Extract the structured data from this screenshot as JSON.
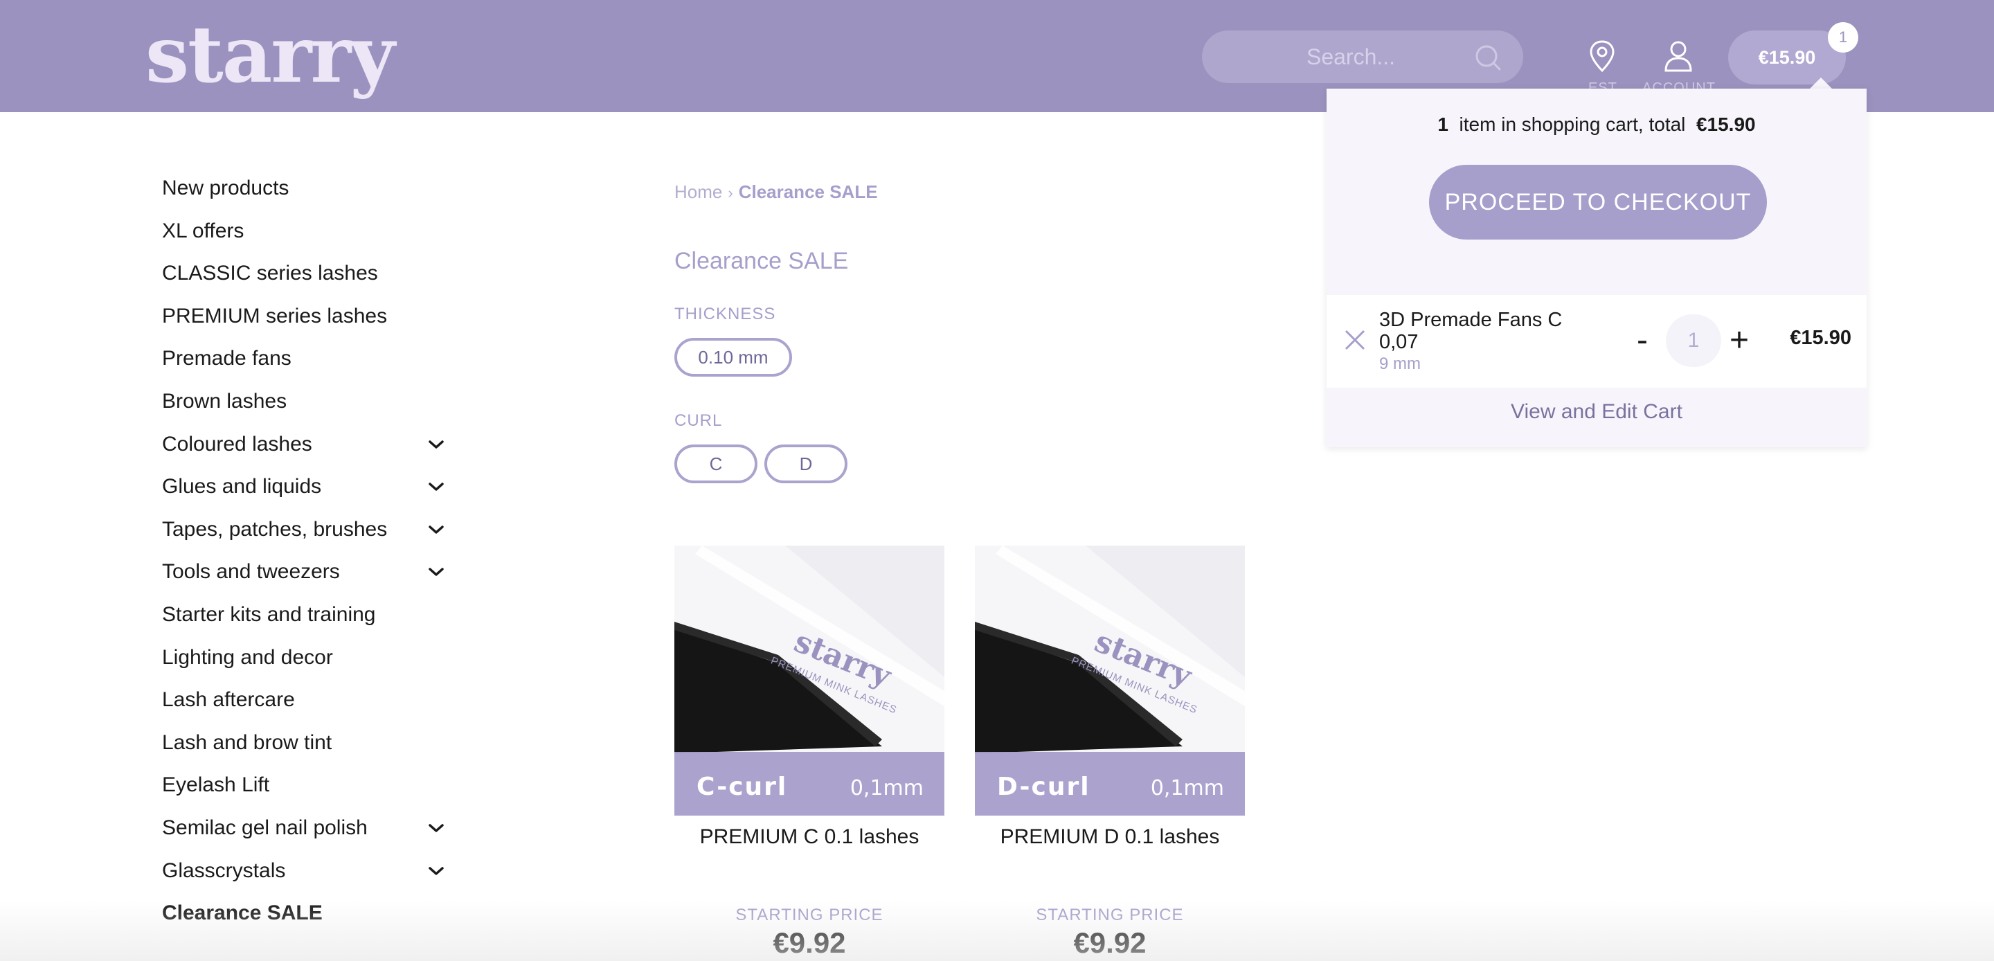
{
  "header": {
    "logo": "starry",
    "search_placeholder": "Search...",
    "est_label": "EST",
    "account_label": "ACCOUNT",
    "cart_total": "€15.90",
    "cart_count": "1"
  },
  "sidebar": {
    "items": [
      {
        "label": "New products",
        "expandable": false
      },
      {
        "label": "XL offers",
        "expandable": false
      },
      {
        "label": "CLASSIC series lashes",
        "expandable": false
      },
      {
        "label": "PREMIUM series lashes",
        "expandable": false
      },
      {
        "label": "Premade fans",
        "expandable": false
      },
      {
        "label": "Brown lashes",
        "expandable": false
      },
      {
        "label": "Coloured lashes",
        "expandable": true
      },
      {
        "label": "Glues and liquids",
        "expandable": true
      },
      {
        "label": "Tapes, patches, brushes",
        "expandable": true
      },
      {
        "label": "Tools and tweezers",
        "expandable": true
      },
      {
        "label": "Starter kits and training",
        "expandable": false
      },
      {
        "label": "Lighting and decor",
        "expandable": false
      },
      {
        "label": "Lash aftercare",
        "expandable": false
      },
      {
        "label": "Lash and brow tint",
        "expandable": false
      },
      {
        "label": "Eyelash Lift",
        "expandable": false
      },
      {
        "label": "Semilac gel nail polish",
        "expandable": true
      },
      {
        "label": "Glasscrystals",
        "expandable": true
      },
      {
        "label": "Clearance SALE",
        "expandable": false,
        "active": true
      }
    ]
  },
  "breadcrumb": {
    "home": "Home",
    "separator": "›",
    "current": "Clearance SALE"
  },
  "main": {
    "title": "Clearance SALE",
    "filters": {
      "thickness_label": "THICKNESS",
      "thickness_options": [
        "0.10 mm"
      ],
      "curl_label": "CURL",
      "curl_options": [
        "C",
        "D"
      ]
    },
    "products": [
      {
        "brand": "starry",
        "sub_brand": "PREMIUM MINK LASHES",
        "curl_label": "C-curl",
        "thickness_label": "0,1mm",
        "name": "PREMIUM C 0.1 lashes",
        "price_label": "STARTING PRICE",
        "price": "€9.92"
      },
      {
        "brand": "starry",
        "sub_brand": "PREMIUM MINK LASHES",
        "curl_label": "D-curl",
        "thickness_label": "0,1mm",
        "name": "PREMIUM D 0.1 lashes",
        "price_label": "STARTING PRICE",
        "price": "€9.92"
      }
    ]
  },
  "cart_dropdown": {
    "count": "1",
    "text_mid": "item in shopping cart, total",
    "total": "€15.90",
    "checkout_label": "PROCEED TO CHECKOUT",
    "item": {
      "name": "3D Premade Fans C 0,07",
      "variant": "9 mm",
      "quantity": "1",
      "minus_label": "-",
      "plus_label": "+",
      "price": "€15.90"
    },
    "view_cart_label": "View and Edit Cart"
  },
  "colors": {
    "brand_purple": "#9c92bf",
    "accent_lavender": "#a69ecb",
    "dropdown_bg": "#f7f5fb"
  }
}
